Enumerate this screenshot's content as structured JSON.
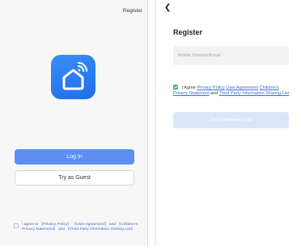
{
  "welcome": {
    "register_label": "Register",
    "login_label": "Log In",
    "guest_label": "Try as Guest",
    "agree": {
      "prefix": "I agree to",
      "privacy": "《Privacy Policy》",
      "user_agreement": "《User Agreement》",
      "and1": "and",
      "children": "《Children's Privacy Statement》",
      "and2": "and",
      "third_party": "《Third Party Information Sharing List》"
    },
    "logo_icon": "smart-home-icon",
    "accent_color": "#5b8ff2"
  },
  "register": {
    "back_icon": "back-arrow-icon",
    "title": "Register",
    "input_placeholder": "Mobile Number/Email",
    "agree": {
      "prefix": "I Agree",
      "privacy": "Privacy Policy",
      "user_agreement": "User Agreement",
      "children": "Children's Privacy Statement",
      "and": "and",
      "third_party": "Third Party Information Sharing List"
    },
    "get_code_label": "Get Verification Code",
    "checkbox_color": "#46b06a"
  }
}
